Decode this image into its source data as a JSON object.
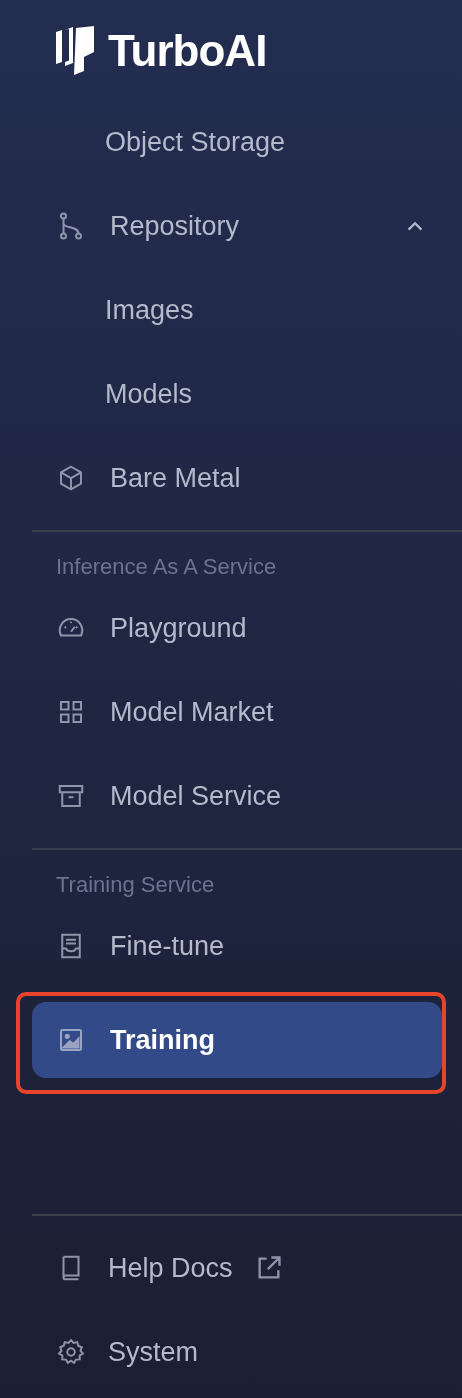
{
  "brand": {
    "name": "TurboAI"
  },
  "sections": [
    {
      "items": [
        {
          "kind": "sub",
          "label": "Object Storage"
        },
        {
          "kind": "group",
          "label": "Repository",
          "expanded": true
        },
        {
          "kind": "sub",
          "label": "Images"
        },
        {
          "kind": "sub",
          "label": "Models"
        },
        {
          "kind": "item",
          "label": "Bare Metal",
          "selected": false
        }
      ]
    },
    {
      "title": "Inference As A Service",
      "items": [
        {
          "kind": "item",
          "label": "Playground",
          "selected": false
        },
        {
          "kind": "item",
          "label": "Model Market",
          "selected": false
        },
        {
          "kind": "item",
          "label": "Model Service",
          "selected": false
        }
      ]
    },
    {
      "title": "Training Service",
      "items": [
        {
          "kind": "item",
          "label": "Fine-tune",
          "selected": false
        },
        {
          "kind": "item",
          "label": "Training",
          "selected": true,
          "annotated": true
        }
      ]
    }
  ],
  "footer": [
    {
      "kind": "external",
      "label": "Help Docs"
    },
    {
      "kind": "item",
      "label": "System",
      "selected": false
    }
  ]
}
